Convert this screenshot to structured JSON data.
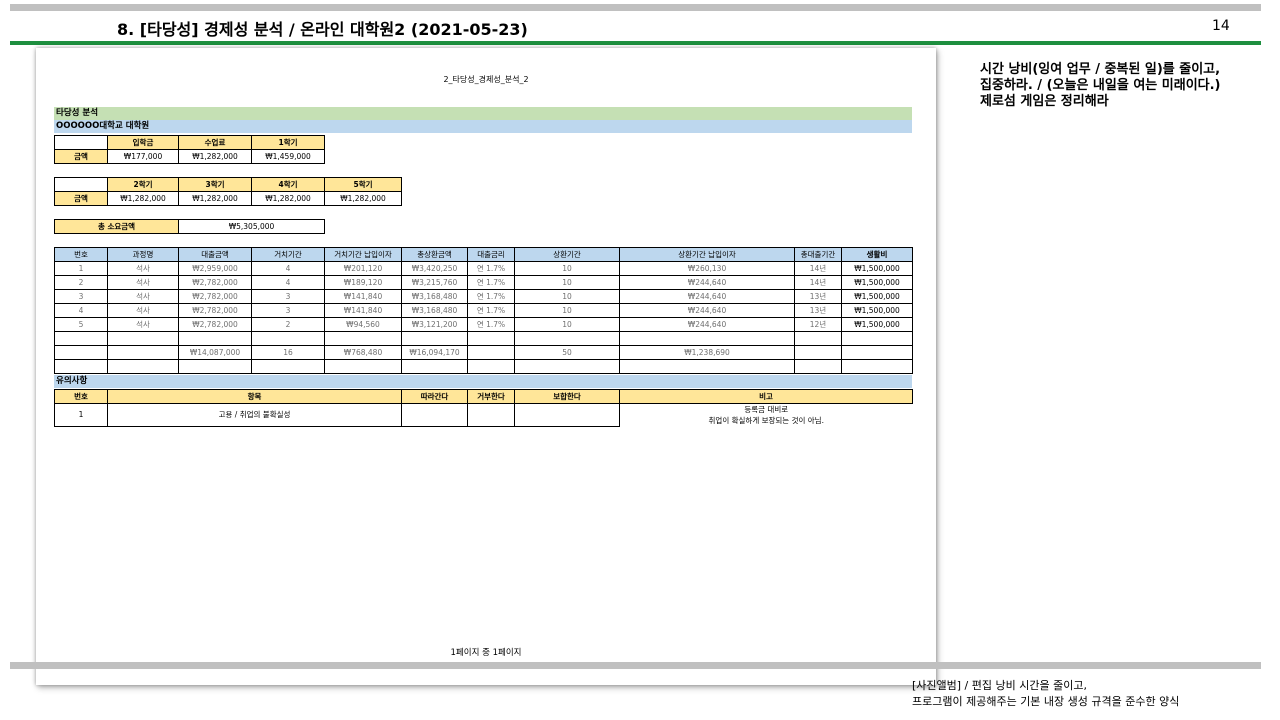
{
  "slide": {
    "title": "8. [타당성] 경제성 분석 / 온라인 대학원2 (2021-05-23)",
    "page_number": "14",
    "right_note": [
      "시간 낭비(잉여 업무 / 중복된 일)를 줄이고,",
      "집중하라. / (오늘은 내일을 여는 미래이다.)",
      "제로섬 게임은 정리해라"
    ],
    "footer_note": [
      "[사진앨범] / 편집 낭비 시간을 줄이고,",
      "프로그램이 제공해주는 기본 내장 생성 규격을 준수한 양식"
    ]
  },
  "sheet": {
    "header": "2_타당성_경제성_분석_2",
    "footer": "1페이지 중 1페이지",
    "section_title": "타당성 분석",
    "school": "OOOOOO대학교 대학원",
    "fees": {
      "headers": [
        "",
        "입학금",
        "수업료",
        "1학기"
      ],
      "row_label": "금액",
      "values": [
        "₩177,000",
        "₩1,282,000",
        "₩1,459,000"
      ]
    },
    "semesters": {
      "headers": [
        "",
        "2학기",
        "3학기",
        "4학기",
        "5학기"
      ],
      "row_label": "금액",
      "values": [
        "₩1,282,000",
        "₩1,282,000",
        "₩1,282,000",
        "₩1,282,000"
      ]
    },
    "total": {
      "label": "총 소요금액",
      "value": "₩5,305,000"
    },
    "loan": {
      "headers": [
        "번호",
        "과정명",
        "대출금액",
        "거치기간",
        "거치기간 납입이자",
        "총상환금액",
        "대출금리",
        "상환기간",
        "상환기간 납입이자",
        "총대출기간",
        "생활비"
      ],
      "rows": [
        [
          "1",
          "석사",
          "₩2,959,000",
          "4",
          "₩201,120",
          "₩3,420,250",
          "연 1.7%",
          "10",
          "₩260,130",
          "14년",
          "₩1,500,000"
        ],
        [
          "2",
          "석사",
          "₩2,782,000",
          "4",
          "₩189,120",
          "₩3,215,760",
          "연 1.7%",
          "10",
          "₩244,640",
          "14년",
          "₩1,500,000"
        ],
        [
          "3",
          "석사",
          "₩2,782,000",
          "3",
          "₩141,840",
          "₩3,168,480",
          "연 1.7%",
          "10",
          "₩244,640",
          "13년",
          "₩1,500,000"
        ],
        [
          "4",
          "석사",
          "₩2,782,000",
          "3",
          "₩141,840",
          "₩3,168,480",
          "연 1.7%",
          "10",
          "₩244,640",
          "13년",
          "₩1,500,000"
        ],
        [
          "5",
          "석사",
          "₩2,782,000",
          "2",
          "₩94,560",
          "₩3,121,200",
          "연 1.7%",
          "10",
          "₩244,640",
          "12년",
          "₩1,500,000"
        ]
      ],
      "totals": [
        "",
        "",
        "₩14,087,000",
        "16",
        "₩768,480",
        "₩16,094,170",
        "",
        "50",
        "₩1,238,690",
        "",
        ""
      ]
    },
    "notes": {
      "title": "유의사항",
      "headers": [
        "번호",
        "항목",
        "따라간다",
        "거부한다",
        "보합한다",
        "비고"
      ],
      "row": [
        "1",
        "고용 / 취업의 불확실성",
        "",
        "",
        ""
      ],
      "remarks": [
        "등록금 대비로",
        "취업이 확실하게 보장되는 것이 아님."
      ]
    }
  }
}
